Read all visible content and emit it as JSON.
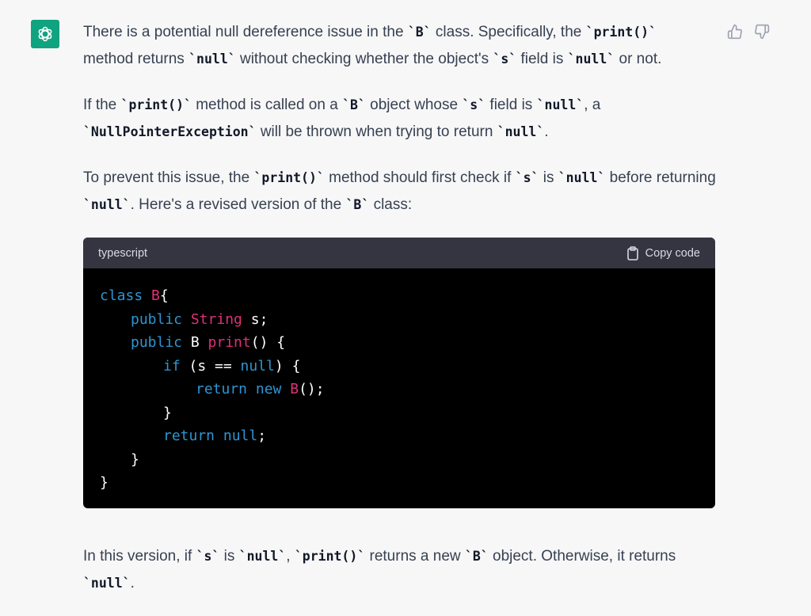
{
  "message": {
    "p1": {
      "t1": "There is a potential null dereference issue in the ",
      "c1": "`B`",
      "t2": " class. Specifically, the ",
      "c2": "`print()`",
      "t3": " method returns ",
      "c3": "`null`",
      "t4": " without checking whether the object's ",
      "c4": "`s`",
      "t5": " field is ",
      "c5": "`null`",
      "t6": " or not."
    },
    "p2": {
      "t1": "If the ",
      "c1": "`print()`",
      "t2": " method is called on a ",
      "c2": "`B`",
      "t3": " object whose ",
      "c3": "`s`",
      "t4": " field is ",
      "c4": "`null`",
      "t5": ", a ",
      "c5": "`NullPointerException`",
      "t6": " will be thrown when trying to return ",
      "c6": "`null`",
      "t7": "."
    },
    "p3": {
      "t1": "To prevent this issue, the ",
      "c1": "`print()`",
      "t2": " method should first check if ",
      "c2": "`s`",
      "t3": " is ",
      "c3": "`null`",
      "t4": " before returning ",
      "c4": "`null`",
      "t5": ". Here's a revised version of the ",
      "c5": "`B`",
      "t6": " class:"
    },
    "p4": {
      "t1": "In this version, if ",
      "c1": "`s`",
      "t2": " is ",
      "c2": "`null`",
      "t3": ", ",
      "c3": "`print()`",
      "t4": " returns a new ",
      "c4": "`B`",
      "t5": " object. Otherwise, it returns ",
      "c5": "`null`",
      "t6": "."
    }
  },
  "code": {
    "language": "typescript",
    "copy_label": "Copy code",
    "l1": {
      "a": "class ",
      "b": "B",
      "c": "{"
    },
    "l2": {
      "a": "public ",
      "b": "String",
      "c": " s;"
    },
    "l3": {
      "a": "public ",
      "b": "B ",
      "c": "print",
      "d": "() {"
    },
    "l4": {
      "a": "if ",
      "b": "(s == ",
      "c": "null",
      "d": ") {"
    },
    "l5": {
      "a": "return new ",
      "b": "B",
      "c": "();"
    },
    "l6": {
      "a": "}"
    },
    "l7": {
      "a": "return null",
      "b": ";"
    },
    "l8": {
      "a": "}"
    },
    "l9": {
      "a": "}"
    }
  },
  "colors": {
    "avatar_bg": "#10a37f",
    "code_header_bg": "#343541",
    "code_bg": "#000000",
    "keyword": "#2e95d3",
    "title": "#df3079"
  },
  "icons": {
    "avatar": "openai-logo-icon",
    "like": "thumbs-up-icon",
    "dislike": "thumbs-down-icon",
    "copy": "clipboard-icon"
  }
}
